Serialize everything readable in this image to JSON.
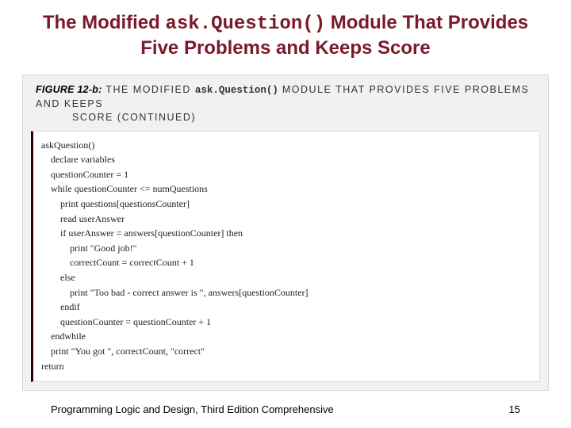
{
  "title": {
    "pre": "The Modified ",
    "code": "ask.Question()",
    "post1": " Module That Provides Five Problems and Keeps Score"
  },
  "figure": {
    "label": "FIGURE 12-b:",
    "caption_before": " THE MODIFIED ",
    "caption_code": "ask.Question()",
    "caption_after": " MODULE THAT PROVIDES FIVE PROBLEMS AND KEEPS",
    "caption_cont": "SCORE (CONTINUED)"
  },
  "code_lines": [
    "askQuestion()",
    "    declare variables",
    "    questionCounter = 1",
    "    while questionCounter <= numQuestions",
    "        print questions[questionsCounter]",
    "        read userAnswer",
    "        if userAnswer = answers[questionCounter] then",
    "            print \"Good job!\"",
    "            correctCount = correctCount + 1",
    "        else",
    "            print \"Too bad - correct answer is \", answers[questionCounter]",
    "        endif",
    "        questionCounter = questionCounter + 1",
    "    endwhile",
    "    print \"You got \", correctCount, \"correct\"",
    "return"
  ],
  "footer": {
    "book": "Programming Logic and Design, Third Edition Comprehensive",
    "page": "15"
  }
}
